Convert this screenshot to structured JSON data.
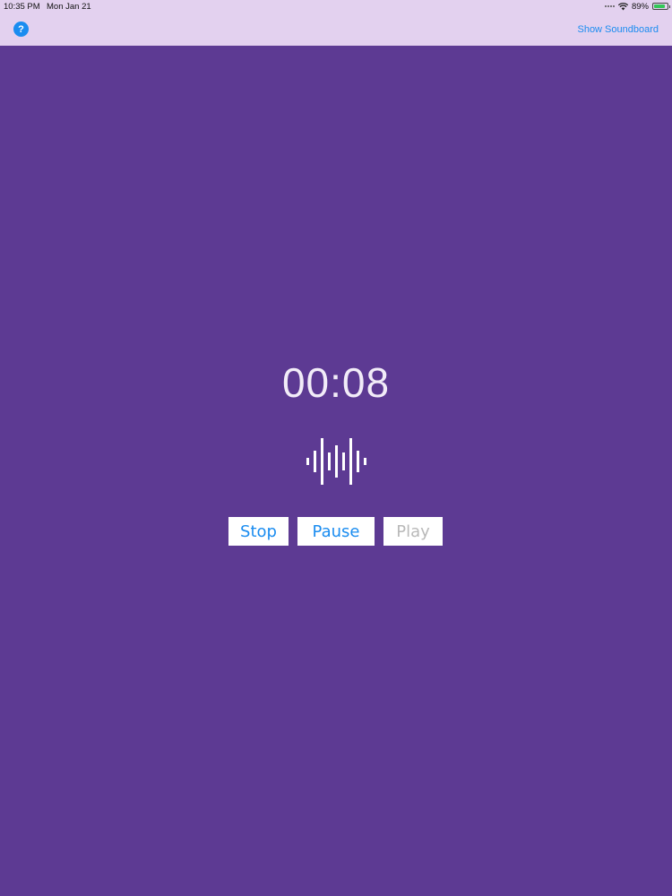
{
  "status_bar": {
    "time": "10:35 PM",
    "date": "Mon Jan 21",
    "battery_percent": "89%",
    "battery_level": 0.89,
    "wifi_icon": "wifi-icon",
    "battery_icon": "battery-charging-icon"
  },
  "nav": {
    "help_label": "?",
    "help_icon": "question-circle-icon",
    "show_soundboard_label": "Show Soundboard"
  },
  "recorder": {
    "timer": "00:08",
    "waveform_icon": "waveform-icon",
    "stop_label": "Stop",
    "pause_label": "Pause",
    "play_label": "Play"
  },
  "colors": {
    "background": "#5d3a93",
    "top_bar": "#e3d1ef",
    "accent": "#1a8cf0",
    "disabled": "#b9b9b9"
  }
}
